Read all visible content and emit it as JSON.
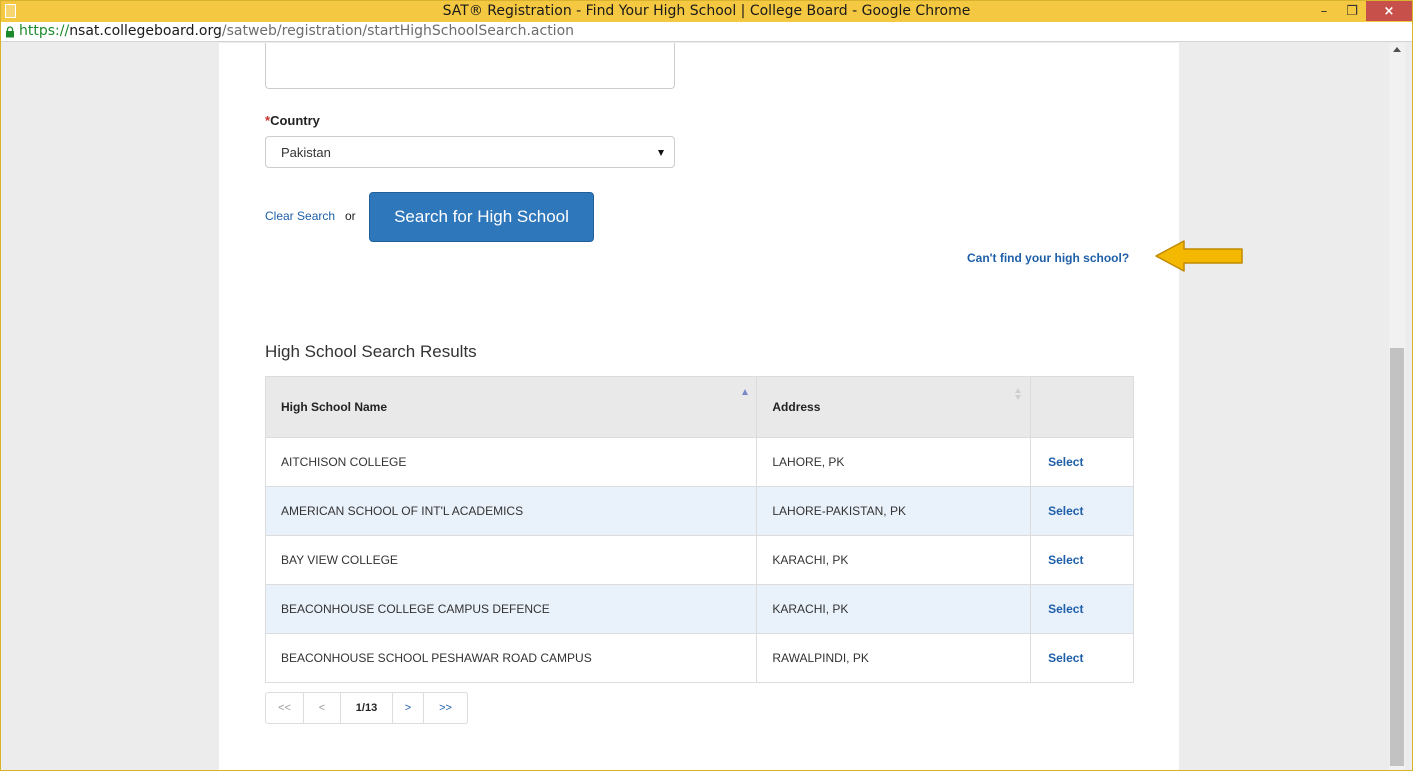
{
  "window": {
    "title": "SAT® Registration - Find Your High School | College Board - Google Chrome",
    "minimize": "–",
    "restore": "❐",
    "close": "×"
  },
  "address_bar": {
    "scheme": "https://",
    "host": "nsat.collegeboard.org",
    "path": "/satweb/registration/startHighSchoolSearch.action"
  },
  "form": {
    "country_label_required": "*",
    "country_label": "Country",
    "country_value": "Pakistan",
    "clear_search": "Clear Search",
    "or": "or",
    "search_button": "Search for High School",
    "cant_find": "Can't find your high school?"
  },
  "results": {
    "title": "High School Search Results",
    "columns": [
      "High School Name",
      "Address",
      ""
    ],
    "rows": [
      {
        "name": "AITCHISON COLLEGE",
        "address": "LAHORE, PK",
        "action": "Select"
      },
      {
        "name": "AMERICAN SCHOOL OF INT'L ACADEMICS",
        "address": "LAHORE-PAKISTAN, PK",
        "action": "Select"
      },
      {
        "name": "BAY VIEW COLLEGE",
        "address": "KARACHI, PK",
        "action": "Select"
      },
      {
        "name": "BEACONHOUSE COLLEGE CAMPUS DEFENCE",
        "address": "KARACHI, PK",
        "action": "Select"
      },
      {
        "name": "BEACONHOUSE SCHOOL PESHAWAR ROAD CAMPUS",
        "address": "RAWALPINDI, PK",
        "action": "Select"
      }
    ]
  },
  "pagination": {
    "first": "<<",
    "prev": "<",
    "current": "1/13",
    "next": ">",
    "last": ">>"
  },
  "colors": {
    "titlebar": "#f5c842",
    "link": "#1e5fa8",
    "button": "#2f77bb",
    "arrow": "#f5b800"
  },
  "icons": {
    "page": "page-icon",
    "lock": "lock-icon",
    "arrow": "left-arrow-icon"
  }
}
